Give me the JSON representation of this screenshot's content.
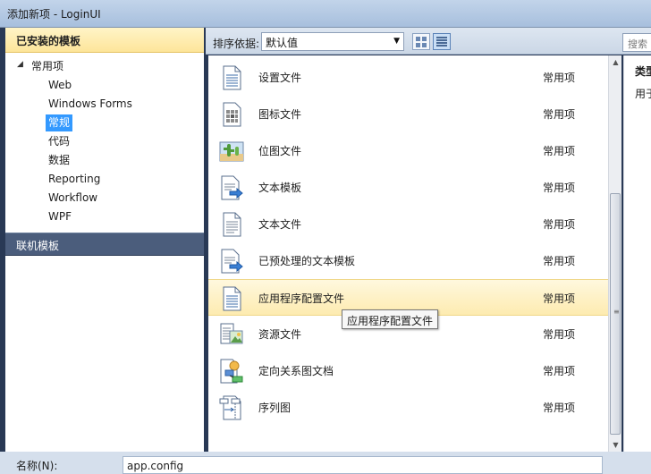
{
  "window": {
    "title": "添加新项 - LoginUI"
  },
  "left_panel": {
    "installed_header": "已安装的模板",
    "tree": [
      {
        "label": "常用项",
        "expanded": true
      },
      {
        "label": "Web"
      },
      {
        "label": "Windows Forms"
      },
      {
        "label": "常规",
        "selected": true
      },
      {
        "label": "代码"
      },
      {
        "label": "数据"
      },
      {
        "label": "Reporting"
      },
      {
        "label": "Workflow"
      },
      {
        "label": "WPF"
      }
    ],
    "expander_glyph": "◢",
    "online_header": "联机模板"
  },
  "toolbar": {
    "sort_label": "排序依据:",
    "sort_value": "默认值",
    "search_placeholder": "搜索"
  },
  "templates": [
    {
      "name": "设置文件",
      "category": "常用项",
      "icon": "settings-file-icon"
    },
    {
      "name": "图标文件",
      "category": "常用项",
      "icon": "icon-file-icon"
    },
    {
      "name": "位图文件",
      "category": "常用项",
      "icon": "bitmap-file-icon"
    },
    {
      "name": "文本模板",
      "category": "常用项",
      "icon": "text-template-icon"
    },
    {
      "name": "文本文件",
      "category": "常用项",
      "icon": "text-file-icon"
    },
    {
      "name": "已预处理的文本模板",
      "category": "常用项",
      "icon": "preprocessed-text-template-icon"
    },
    {
      "name": "应用程序配置文件",
      "category": "常用项",
      "icon": "app-config-file-icon",
      "hover": true
    },
    {
      "name": "资源文件",
      "category": "常用项",
      "icon": "resource-file-icon"
    },
    {
      "name": "定向关系图文档",
      "category": "常用项",
      "icon": "directed-graph-icon"
    },
    {
      "name": "序列图",
      "category": "常用项",
      "icon": "sequence-diagram-icon"
    }
  ],
  "tooltip": "应用程序配置文件",
  "details": {
    "type_label": "类型",
    "description": "用于"
  },
  "bottom": {
    "name_label": "名称(N):",
    "name_value": "app.config"
  },
  "colors": {
    "selection": "#3399ff",
    "hover_row": "#fdebb0",
    "frame": "#293955"
  }
}
